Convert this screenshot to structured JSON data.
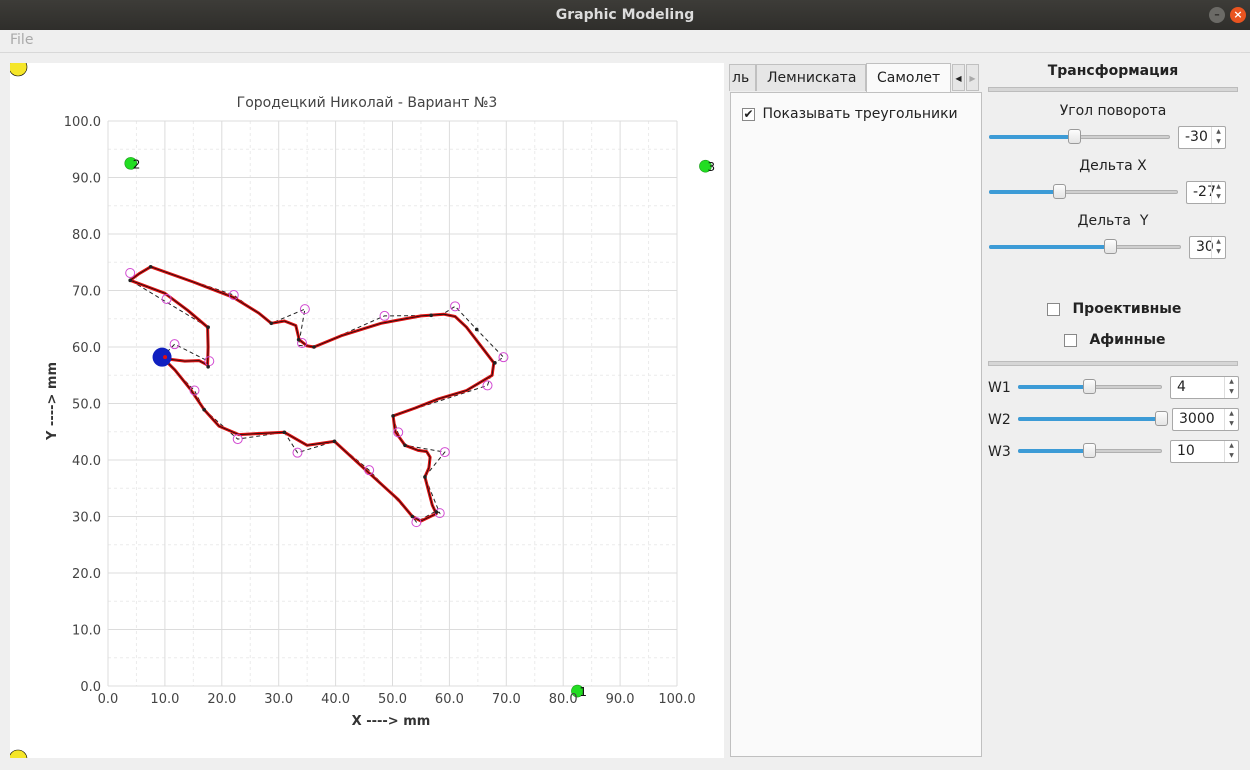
{
  "window": {
    "title": "Graphic Modeling",
    "minimize_glyph": "–",
    "close_glyph": "×"
  },
  "menubar": {
    "file": "File"
  },
  "plot": {
    "chart_data": {
      "type": "scatter",
      "title": "Городецкий Николай - Вариант №3",
      "xlabel": "X ----> mm",
      "ylabel": "Y ----> mm",
      "xlim": [
        0,
        100
      ],
      "ylim": [
        0,
        100
      ],
      "xticks": [
        "0.0",
        "10.0",
        "20.0",
        "30.0",
        "40.0",
        "50.0",
        "60.0",
        "70.0",
        "80.0",
        "90.0",
        "100.0"
      ],
      "yticks": [
        "0.0",
        "10.0",
        "20.0",
        "30.0",
        "40.0",
        "50.0",
        "60.0",
        "70.0",
        "80.0",
        "90.0",
        "100.0"
      ],
      "grid": true,
      "grid_color": "#dcdcdc",
      "curve_color": "#e01010",
      "control_line_color": "#222222",
      "control_point_color": "#d24bd2",
      "anchor_color": "#1020c0",
      "marker_color": "#22dd22",
      "curve_points": [
        [
          9.5,
          58.2
        ],
        [
          11,
          57.8
        ],
        [
          13.5,
          57.5
        ],
        [
          16,
          57.6
        ],
        [
          17.5,
          56.8
        ],
        [
          17.6,
          60
        ],
        [
          17.5,
          63.5
        ],
        [
          14,
          66.5
        ],
        [
          10,
          69.5
        ],
        [
          3.9,
          71.8
        ],
        [
          5.5,
          73
        ],
        [
          7.5,
          74.2
        ],
        [
          15,
          71.5
        ],
        [
          22,
          68.8
        ],
        [
          26.5,
          66
        ],
        [
          28.7,
          64.2
        ],
        [
          31,
          64.6
        ],
        [
          33,
          63.8
        ],
        [
          33.6,
          61.3
        ],
        [
          35,
          60.2
        ],
        [
          36.2,
          60
        ],
        [
          41,
          62
        ],
        [
          48,
          64.2
        ],
        [
          55,
          65.5
        ],
        [
          59,
          65.8
        ],
        [
          61,
          65.4
        ],
        [
          63,
          63.5
        ],
        [
          67.8,
          57.2
        ],
        [
          67.5,
          55
        ],
        [
          63,
          52.3
        ],
        [
          58,
          50.8
        ],
        [
          54,
          49.2
        ],
        [
          50.1,
          47.8
        ],
        [
          50.5,
          45
        ],
        [
          52.2,
          42.6
        ],
        [
          54.5,
          41.7
        ],
        [
          56,
          41.5
        ],
        [
          56.6,
          40.5
        ],
        [
          56.4,
          38.6
        ],
        [
          55.7,
          37
        ],
        [
          57,
          32
        ],
        [
          57.7,
          30.5
        ],
        [
          55,
          29.2
        ],
        [
          53.5,
          30
        ],
        [
          51,
          33
        ],
        [
          45,
          38.5
        ],
        [
          39.8,
          43.3
        ],
        [
          35,
          42.6
        ],
        [
          31,
          44.9
        ],
        [
          27,
          44.7
        ],
        [
          23,
          44.5
        ],
        [
          19.5,
          46
        ],
        [
          16.9,
          48.9
        ],
        [
          14.5,
          52.5
        ],
        [
          11.8,
          55.9
        ],
        [
          9.5,
          58.2
        ]
      ],
      "control_polyline": [
        [
          9.5,
          58.2
        ],
        [
          11.7,
          60.5
        ],
        [
          17.6,
          57.5
        ],
        [
          17.6,
          63.5
        ],
        [
          3.9,
          71.8
        ],
        [
          7.5,
          74.2
        ],
        [
          22.1,
          69.2
        ],
        [
          28.7,
          64.2
        ],
        [
          34.6,
          66.7
        ],
        [
          33.5,
          60.3
        ],
        [
          36.2,
          60
        ],
        [
          48.6,
          65.5
        ],
        [
          58.5,
          65.6
        ],
        [
          61,
          67.2
        ],
        [
          64.8,
          63.1
        ],
        [
          69.5,
          58.2
        ],
        [
          68,
          57.2
        ],
        [
          66.7,
          53.2
        ],
        [
          50.1,
          47.8
        ],
        [
          50.9,
          44.9
        ],
        [
          52.2,
          42.6
        ],
        [
          59.2,
          41.4
        ],
        [
          55.7,
          37
        ],
        [
          58.3,
          30.6
        ],
        [
          57.7,
          31
        ],
        [
          54.2,
          29
        ],
        [
          53.5,
          30
        ],
        [
          45.9,
          38.2
        ],
        [
          39.8,
          43.3
        ],
        [
          33.3,
          41.3
        ],
        [
          31,
          44.9
        ],
        [
          22.8,
          43.7
        ],
        [
          16.9,
          48.9
        ],
        [
          15.2,
          52.3
        ],
        [
          9.5,
          58.2
        ]
      ],
      "control_points": [
        [
          11.7,
          60.5
        ],
        [
          17.8,
          57.5
        ],
        [
          3.9,
          73.1
        ],
        [
          10.3,
          68.5
        ],
        [
          22.1,
          69.2
        ],
        [
          34.6,
          66.7
        ],
        [
          34.1,
          60.7
        ],
        [
          48.6,
          65.5
        ],
        [
          61,
          67.2
        ],
        [
          69.5,
          58.2
        ],
        [
          66.7,
          53.2
        ],
        [
          51,
          44.9
        ],
        [
          59.2,
          41.4
        ],
        [
          58.3,
          30.6
        ],
        [
          54.2,
          29
        ],
        [
          45.9,
          38.2
        ],
        [
          33.3,
          41.3
        ],
        [
          22.8,
          43.7
        ],
        [
          15.2,
          52.3
        ]
      ],
      "node_points": [
        [
          3.9,
          71.8
        ],
        [
          7.5,
          74.2
        ],
        [
          17.6,
          63.5
        ],
        [
          17.6,
          56.5
        ],
        [
          28.7,
          64.2
        ],
        [
          33.5,
          61.3
        ],
        [
          36.2,
          60
        ],
        [
          56.8,
          65.6
        ],
        [
          64.8,
          63.1
        ],
        [
          68,
          57.2
        ],
        [
          50.1,
          47.8
        ],
        [
          52.2,
          42.6
        ],
        [
          55.7,
          37
        ],
        [
          57.7,
          30.8
        ],
        [
          53.5,
          30
        ],
        [
          39.8,
          43.3
        ],
        [
          31,
          44.9
        ],
        [
          16.9,
          48.9
        ]
      ],
      "anchor": [
        9.5,
        58.2
      ],
      "markers": [
        {
          "label": "2",
          "x": 4,
          "y": 92.5
        },
        {
          "label": "3",
          "x": 105,
          "y": 92
        },
        {
          "label": "1",
          "x": 82.5,
          "y": -0.9
        }
      ]
    }
  },
  "tabs": {
    "items": [
      "ль",
      "Лемниската",
      "Самолет"
    ],
    "active_index": 2,
    "scroll_left": "◀",
    "scroll_right": "▶",
    "show_triangles_label": "Показывать треугольники",
    "show_triangles_checked": "✔"
  },
  "transform": {
    "heading": "Трансформация",
    "rotation": {
      "label": "Угол поворота",
      "value": "-30",
      "fraction": 0.47
    },
    "delta_x": {
      "label": "Дельта X",
      "value": "-27",
      "fraction": 0.37
    },
    "delta_y": {
      "label": "Дельта  Y",
      "value": "30",
      "fraction": 0.63
    },
    "projective_label": "Проективные",
    "affine_label": "Афинные",
    "w1": {
      "label": "W1",
      "value": "4",
      "fraction": 0.49
    },
    "w2": {
      "label": "W2",
      "value": "3000",
      "fraction": 1.0
    },
    "w3": {
      "label": "W3",
      "value": "10",
      "fraction": 0.49
    },
    "spin_up": "▲",
    "spin_down": "▼"
  }
}
